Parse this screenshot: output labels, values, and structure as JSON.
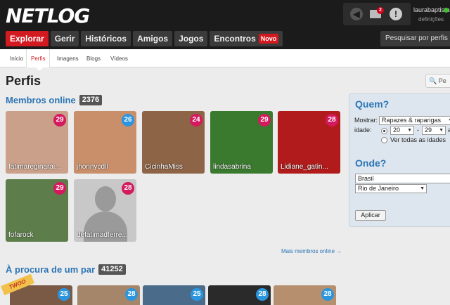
{
  "header": {
    "logo": "NETLOG",
    "username": "laurabaptista",
    "settings_label": "definições",
    "mail_count": "2",
    "alert_symbol": "!",
    "search_button": "Pesquisar por perfis"
  },
  "main_nav": [
    {
      "label": "Explorar",
      "active": true
    },
    {
      "label": "Gerir"
    },
    {
      "label": "Históricos"
    },
    {
      "label": "Amigos"
    },
    {
      "label": "Jogos"
    },
    {
      "label": "Encontros",
      "badge": "Novo"
    }
  ],
  "sub_nav": [
    {
      "label": "Início"
    },
    {
      "label": "Perfis",
      "active": true
    },
    {
      "label": "Imagens"
    },
    {
      "label": "Blogs"
    },
    {
      "label": "Vídeos"
    }
  ],
  "page_title": "Perfis",
  "search_box": {
    "placeholder": "Pe"
  },
  "online_section": {
    "title": "Membros online",
    "count": "2376",
    "members": [
      {
        "name": "fatimareginarai...",
        "age": "29",
        "gender": "f",
        "color": "#caa08a"
      },
      {
        "name": "jhonnycdll",
        "age": "26",
        "gender": "m",
        "color": "#c98f6b"
      },
      {
        "name": "CicinhaMiss",
        "age": "24",
        "gender": "f",
        "color": "#8e6446"
      },
      {
        "name": "lindasabrina",
        "age": "29",
        "gender": "f",
        "color": "#3a7a2f"
      },
      {
        "name": "Lidiane_gatin...",
        "age": "28",
        "gender": "f",
        "color": "#b21b1b"
      },
      {
        "name": "fofarock",
        "age": "29",
        "gender": "f",
        "color": "#5d7d4a"
      },
      {
        "name": "defatimadferre...",
        "age": "28",
        "gender": "f",
        "color": "#c8c8c8"
      }
    ],
    "more_link": "Mais membros online →"
  },
  "pair_section": {
    "title": "À procura de um par",
    "count": "41252",
    "ribbon": "TWOO",
    "members": [
      {
        "age": "25",
        "color": "#7a5a44"
      },
      {
        "age": "28",
        "color": "#a6866a"
      },
      {
        "age": "25",
        "color": "#4a6b8a"
      },
      {
        "age": "28",
        "color": "#2a2a2a"
      },
      {
        "age": "28",
        "color": "#b58f6e"
      }
    ]
  },
  "filter_panel": {
    "who_title": "Quem?",
    "show_label": "Mostrar:",
    "show_value": "Rapazes & raparigas",
    "age_label": "idade:",
    "age_from": "20",
    "age_sep": "-",
    "age_to": "29",
    "age_suffix": "a",
    "all_ages_label": "Ver todas as idades",
    "where_title": "Onde?",
    "country_value": "Brasil",
    "region_value": "Rio de Janeiro",
    "apply_label": "Aplicar"
  }
}
